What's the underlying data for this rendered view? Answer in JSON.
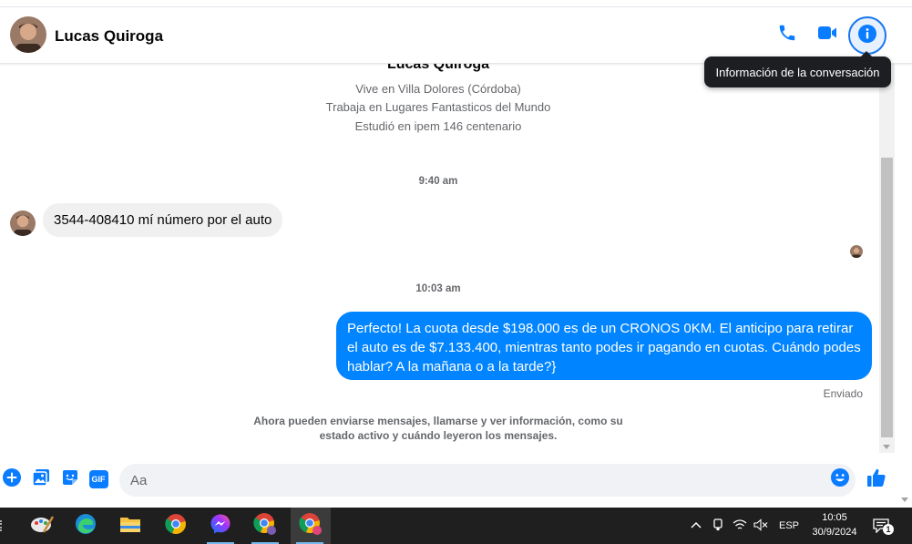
{
  "header": {
    "contact_name": "Lucas Quiroga",
    "tooltip": "Información de la conversación",
    "icons": {
      "call": "phone-icon",
      "video": "video-camera-icon",
      "info": "info-icon"
    }
  },
  "profile": {
    "name": "Lucas Quiroga",
    "lines": [
      "Vive en Villa Dolores (Córdoba)",
      "Trabaja en Lugares Fantasticos del Mundo",
      "Estudió en ipem 146 centenario"
    ]
  },
  "messages": [
    {
      "type": "timestamp",
      "text": "9:40 am"
    },
    {
      "type": "incoming",
      "text": "3544-408410 mí número por el auto"
    },
    {
      "type": "timestamp",
      "text": "10:03 am"
    },
    {
      "type": "outgoing",
      "text": "Perfecto! La cuota desde $198.000 es de un CRONOS 0KM. El anticipo para retirar el auto es de $7.133.400, mientras tanto podes ir pagando en cuotas. Cuándo podes hablar? A la mañana o a la tarde?}"
    }
  ],
  "status": {
    "sent": "Enviado"
  },
  "notice": "Ahora pueden enviarse mensajes, llamarse y ver información, como su estado activo y cuándo leyeron los mensajes.",
  "composer": {
    "placeholder": "Aa",
    "icons": [
      "plus-circle-icon",
      "photo-gallery-icon",
      "sticker-icon",
      "gif-icon",
      "emoji-icon",
      "thumbs-up-icon"
    ],
    "gif_label": "GIF"
  },
  "taskbar": {
    "apps": [
      "paint-icon",
      "edge-icon",
      "file-explorer-icon",
      "chrome-icon",
      "messenger-icon",
      "chrome-profile-icon",
      "chrome-active-icon"
    ],
    "language": "ESP",
    "time": "10:05",
    "date": "30/9/2024",
    "notifications": "1"
  },
  "colors": {
    "accent": "#0084ff",
    "brand_blue": "#1877f2",
    "incoming_bubble": "#f0f0f0",
    "taskbar": "#1f1f1f"
  }
}
